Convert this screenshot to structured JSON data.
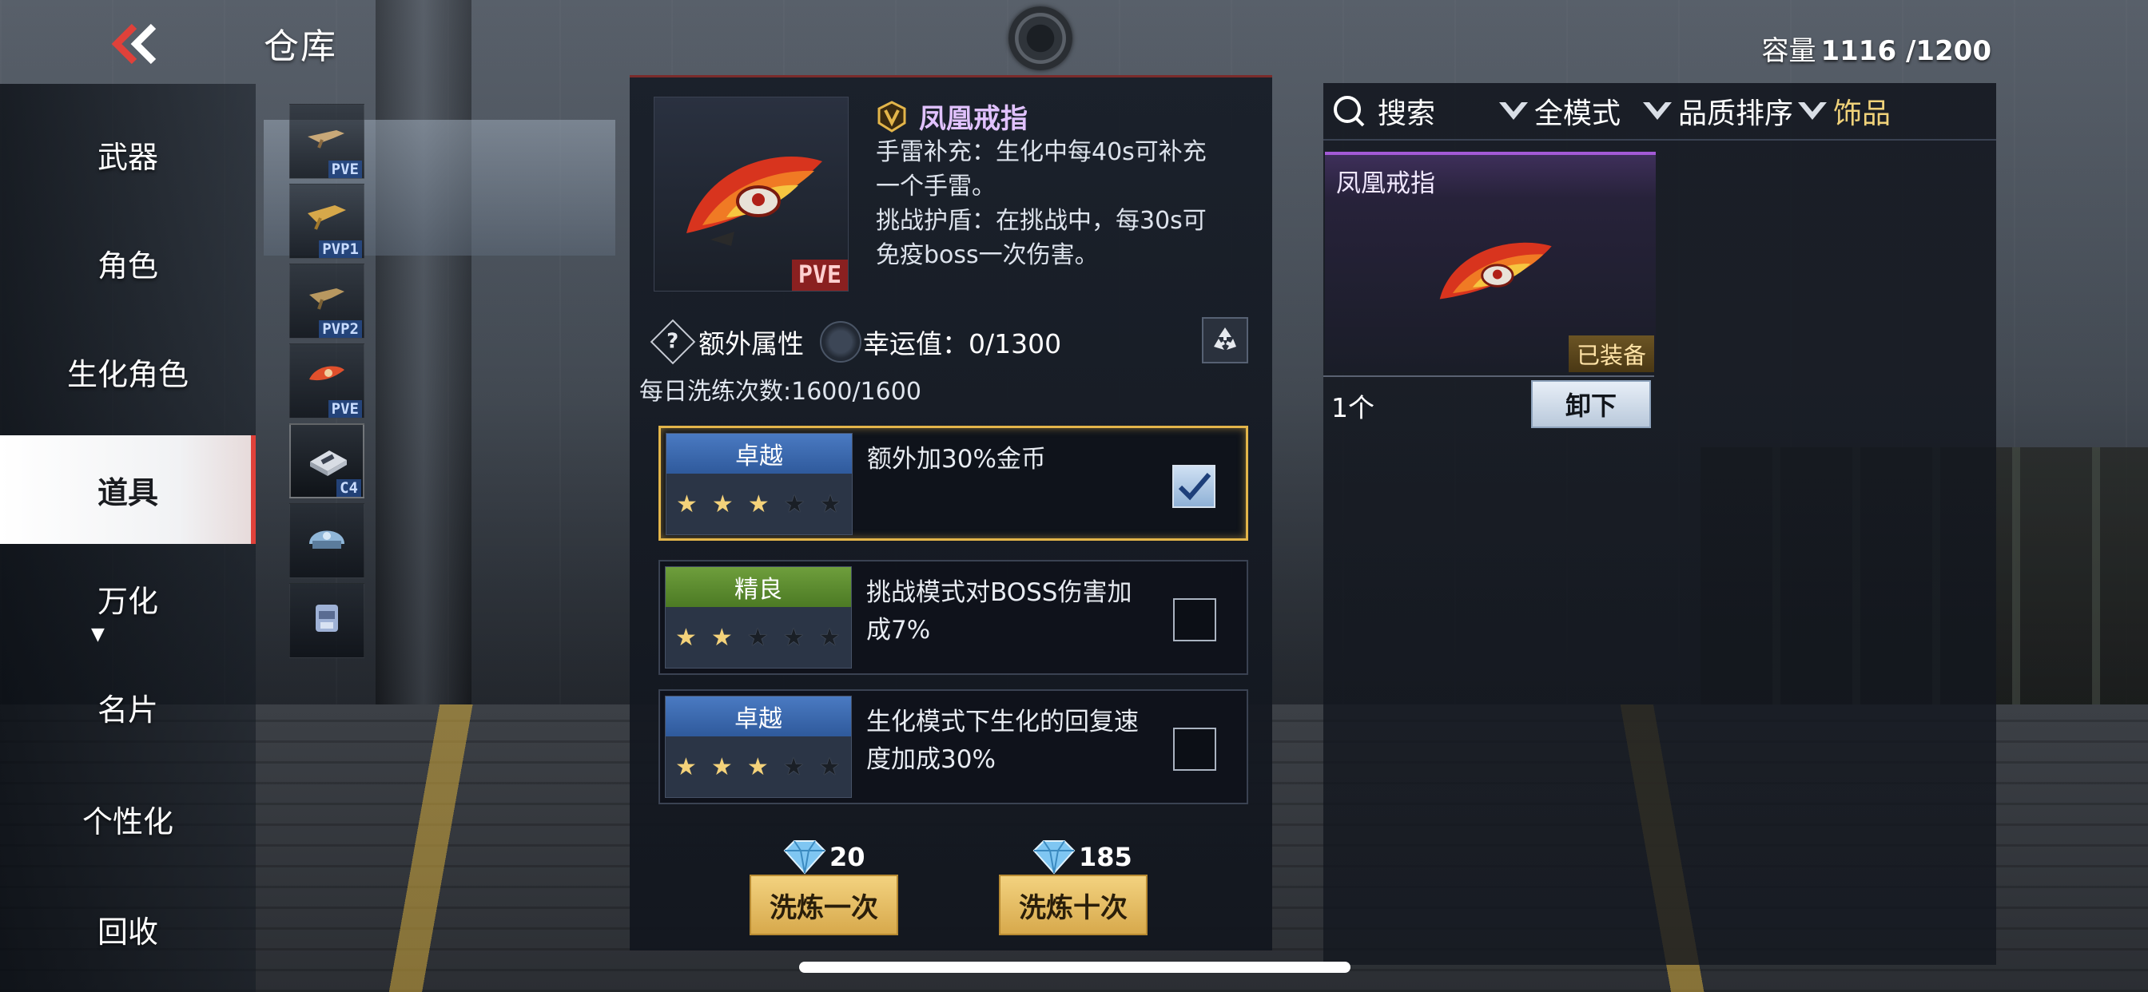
{
  "header": {
    "title": "仓库",
    "capacity_label": "容量",
    "capacity_value": "1116 /1200"
  },
  "nav": {
    "items": [
      {
        "label": "武器"
      },
      {
        "label": "角色"
      },
      {
        "label": "生化角色"
      },
      {
        "label": "道具",
        "active": true
      },
      {
        "label": "万化"
      },
      {
        "label": "名片"
      },
      {
        "label": "个性化"
      },
      {
        "label": "回收"
      }
    ]
  },
  "thumbs": [
    {
      "tag": "PVE"
    },
    {
      "tag": "PVP1"
    },
    {
      "tag": "PVP2"
    },
    {
      "tag": "PVE"
    },
    {
      "tag": "C4"
    },
    {
      "tag": ""
    },
    {
      "tag": ""
    }
  ],
  "detail": {
    "item_name": "凤凰戒指",
    "mode_badge": "PVE",
    "desc_lines": [
      "手雷补充：生化中每40s可补充",
      "一个手雷。",
      "挑战护盾：在挑战中，每30s可",
      "免疫boss一次伤害。"
    ],
    "extra_attr_label": "额外属性",
    "luck_label": "幸运值：0/1300",
    "daily_count": "每日洗练次数:1600/1600",
    "attributes": [
      {
        "grade": "卓越",
        "grade_color": "#3d6cb3",
        "stars": 3,
        "text": "额外加30%金币",
        "checked": true
      },
      {
        "grade": "精良",
        "grade_color": "#5f8c30",
        "stars": 2,
        "text": "挑战模式对BOSS伤害加成7%",
        "checked": false
      },
      {
        "grade": "卓越",
        "grade_color": "#3d6cb3",
        "stars": 3,
        "text": "生化模式下生化的回复速度加成30%",
        "checked": false
      }
    ],
    "refine_once": {
      "cost": "20",
      "label": "洗炼一次"
    },
    "refine_ten": {
      "cost": "185",
      "label": "洗炼十次"
    }
  },
  "right": {
    "search_label": "搜索",
    "filters": [
      "全模式",
      "品质排序",
      "饰品"
    ],
    "card": {
      "name": "凤凰戒指",
      "equipped_label": "已装备",
      "count": "1个",
      "unequip_label": "卸下"
    }
  },
  "icons": {
    "back": "double-chevron-left-icon",
    "search": "search-icon",
    "recycle": "recycle-icon",
    "diamond": "diamond-icon",
    "check": "check-icon"
  },
  "colors": {
    "accent_gold": "#e3b54a",
    "active_nav_marker": "#e0413a",
    "item_name_purple": "#e1c2ff"
  }
}
